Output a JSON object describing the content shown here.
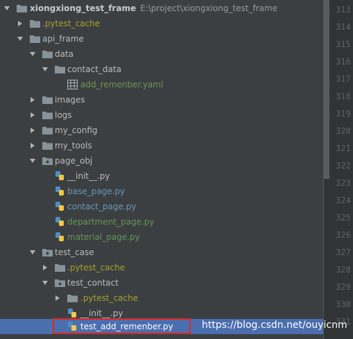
{
  "tree": {
    "root": {
      "name": "xiongxiong_test_frame",
      "path": "E:\\project\\xiongxiong_test_frame"
    },
    "items": [
      {
        "label": ".pytest_cache",
        "kind": "folder",
        "expanded": false,
        "color": "pytest"
      },
      {
        "label": "api_frame",
        "kind": "folder",
        "expanded": true,
        "color": "normal"
      },
      {
        "label": "data",
        "kind": "folder",
        "expanded": true,
        "color": "normal"
      },
      {
        "label": "contact_data",
        "kind": "folder",
        "expanded": true,
        "color": "normal"
      },
      {
        "label": "add_remenber.yaml",
        "kind": "yaml",
        "color": "green"
      },
      {
        "label": "images",
        "kind": "folder",
        "expanded": false,
        "color": "normal"
      },
      {
        "label": "logs",
        "kind": "folder",
        "expanded": false,
        "color": "normal"
      },
      {
        "label": "my_config",
        "kind": "folder",
        "expanded": false,
        "color": "normal"
      },
      {
        "label": "my_tools",
        "kind": "folder",
        "expanded": false,
        "color": "normal"
      },
      {
        "label": "page_obj",
        "kind": "folder",
        "expanded": true,
        "color": "normal"
      },
      {
        "label": "__init__.py",
        "kind": "python",
        "color": "normal"
      },
      {
        "label": "base_page.py",
        "kind": "python",
        "color": "blue"
      },
      {
        "label": "contact_page.py",
        "kind": "python",
        "color": "blue"
      },
      {
        "label": "department_page.py",
        "kind": "python",
        "color": "green"
      },
      {
        "label": "material_page.py",
        "kind": "python",
        "color": "green"
      },
      {
        "label": "test_case",
        "kind": "folder",
        "expanded": true,
        "color": "normal"
      },
      {
        "label": ".pytest_cache",
        "kind": "folder",
        "expanded": false,
        "color": "pytest"
      },
      {
        "label": "test_contact",
        "kind": "folder",
        "expanded": true,
        "color": "normal"
      },
      {
        "label": ".pytest_cache",
        "kind": "folder",
        "expanded": false,
        "color": "pytest"
      },
      {
        "label": "__init__.py",
        "kind": "python",
        "color": "normal"
      },
      {
        "label": "test_add_remenber.py",
        "kind": "python",
        "color": "normal",
        "selected": true
      }
    ]
  },
  "gutter": {
    "line_numbers": [
      "313",
      "314",
      "315",
      "316",
      "317",
      "318",
      "319",
      "320",
      "321",
      "322",
      "323",
      "324",
      "325",
      "326",
      "327",
      "328",
      "329",
      "330",
      "331"
    ]
  },
  "watermark": "https://blog.csdn.net/ouyicnm",
  "colors": {
    "background": "#3c3f41",
    "selection": "#4b6eaf",
    "highlight_border": "#e0261c",
    "pytest_cache": "#a7a12b",
    "modified_blue": "#6897bb",
    "added_green": "#6a9955"
  }
}
